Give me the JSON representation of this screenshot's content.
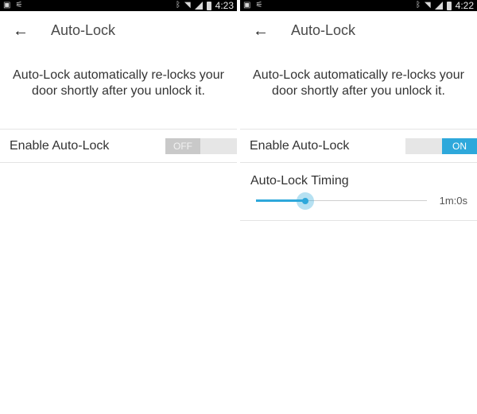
{
  "panels": [
    {
      "statusbar": {
        "time": "4:23",
        "left_icons": [
          "image-icon",
          "usb-debug-icon"
        ],
        "right_icons": [
          "bluetooth-icon",
          "wifi-icon",
          "signal-icon",
          "battery-icon"
        ]
      },
      "title": "Auto-Lock",
      "description": "Auto-Lock automatically re-locks your door shortly after you unlock it.",
      "enable_label": "Enable Auto-Lock",
      "toggle": {
        "state": "off",
        "label": "OFF"
      }
    },
    {
      "statusbar": {
        "time": "4:22",
        "left_icons": [
          "image-icon",
          "usb-debug-icon"
        ],
        "right_icons": [
          "bluetooth-icon",
          "wifi-icon",
          "signal-icon",
          "battery-icon"
        ]
      },
      "title": "Auto-Lock",
      "description": "Auto-Lock automatically re-locks your door shortly after you unlock it.",
      "enable_label": "Enable Auto-Lock",
      "toggle": {
        "state": "on",
        "label": "ON"
      },
      "timing": {
        "label": "Auto-Lock Timing",
        "value_text": "1m:0s",
        "slider_fraction": 0.29
      }
    }
  ],
  "colors": {
    "accent": "#2ea8db",
    "statusbar": "#000000"
  }
}
